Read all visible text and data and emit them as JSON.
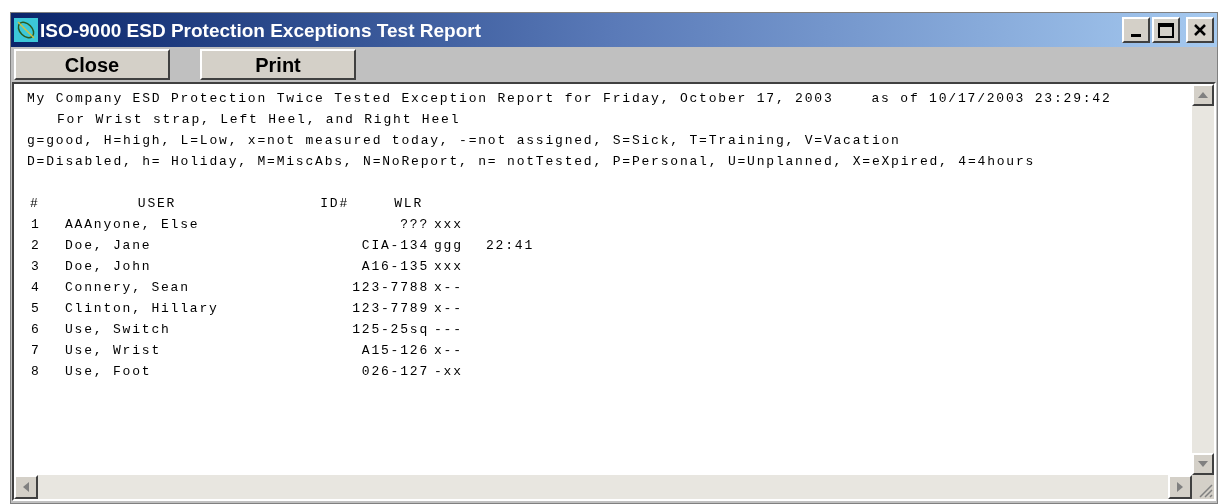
{
  "window": {
    "title": "ISO-9000 ESD Protection Exceptions Test Report"
  },
  "toolbar": {
    "buttons": [
      "Close",
      "Print"
    ]
  },
  "report": {
    "title": "My Company ESD Protection Twice Tested Exception Report for Friday, October 17, 2003",
    "as_of": "as of 10/17/2003 23:29:42",
    "subtitle": "For Wrist strap, Left Heel, and Right Heel",
    "legend": [
      "g=good, H=high, L=Low, x=not measured today, -=not assigned, S=Sick, T=Training, V=Vacation",
      "D=Disabled, h= Holiday, M=MiscAbs, N=NoReport, n= notTested, P=Personal, U=Unplanned, X=eXpired, 4=4hours"
    ],
    "table": {
      "columns": [
        "#",
        "USER",
        "ID#",
        "WLR"
      ],
      "rows": [
        {
          "number": "1",
          "user": "AAAnyone, Else",
          "id": "???",
          "wlr": "xxx"
        },
        {
          "number": "2",
          "user": "Doe, Jane",
          "id": "CIA-134",
          "wlr": "ggg",
          "time": "22:41"
        },
        {
          "number": "3",
          "user": "Doe, John",
          "id": "A16-135",
          "wlr": "xxx"
        },
        {
          "number": "4",
          "user": "Connery, Sean",
          "id": "123-7788",
          "wlr": "x--"
        },
        {
          "number": "5",
          "user": "Clinton, Hillary",
          "id": "123-7789",
          "wlr": "x--"
        },
        {
          "number": "6",
          "user": "Use, Switch",
          "id": "125-25sq",
          "wlr": "---"
        },
        {
          "number": "7",
          "user": "Use, Wrist",
          "id": "A15-126",
          "wlr": "x--"
        },
        {
          "number": "8",
          "user": "Use, Foot",
          "id": "026-127",
          "wlr": "-xx"
        }
      ]
    }
  }
}
